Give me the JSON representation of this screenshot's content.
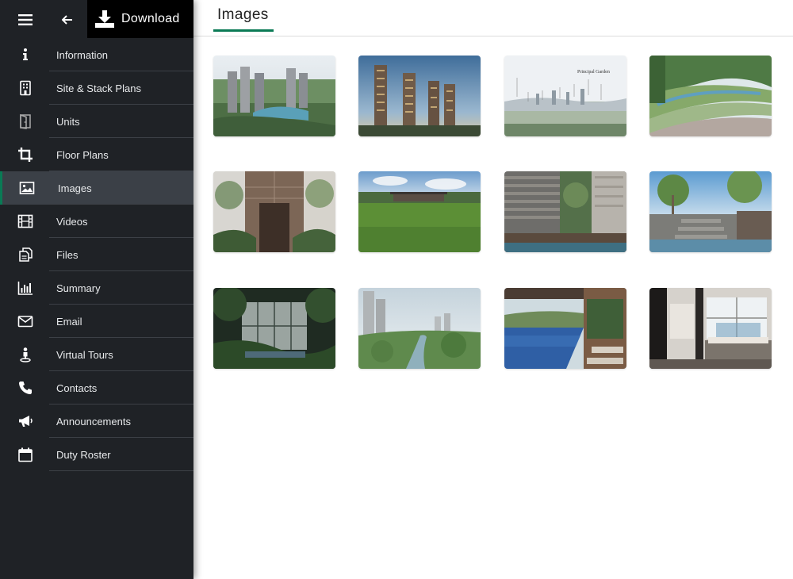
{
  "toolbar": {
    "menu_icon": "hamburger-menu-icon",
    "back_icon": "arrow-left-icon",
    "download_label": "Download",
    "download_icon": "download-icon"
  },
  "sidebar": {
    "items": [
      {
        "label": "Information",
        "icon": "info-icon"
      },
      {
        "label": "Site & Stack Plans",
        "icon": "building-icon"
      },
      {
        "label": "Units",
        "icon": "door-icon"
      },
      {
        "label": "Floor Plans",
        "icon": "crop-icon"
      },
      {
        "label": "Images",
        "icon": "image-icon",
        "active": true
      },
      {
        "label": "Videos",
        "icon": "film-icon"
      },
      {
        "label": "Files",
        "icon": "files-icon"
      },
      {
        "label": "Summary",
        "icon": "bar-chart-icon"
      },
      {
        "label": "Email",
        "icon": "envelope-icon"
      },
      {
        "label": "Virtual Tours",
        "icon": "person-pin-icon"
      },
      {
        "label": "Contacts",
        "icon": "phone-icon"
      },
      {
        "label": "Announcements",
        "icon": "megaphone-icon"
      },
      {
        "label": "Duty Roster",
        "icon": "calendar-icon"
      }
    ]
  },
  "main": {
    "title": "Images",
    "images": [
      {
        "name": "aerial-view-towers"
      },
      {
        "name": "towers-dusk"
      },
      {
        "name": "principal-garden-map",
        "caption": "Principal Garden"
      },
      {
        "name": "terraced-garden"
      },
      {
        "name": "entrance-lobby"
      },
      {
        "name": "lawn-pavilion"
      },
      {
        "name": "stone-wall-courtyard"
      },
      {
        "name": "garden-steps"
      },
      {
        "name": "night-pavilion"
      },
      {
        "name": "riverside-park"
      },
      {
        "name": "lap-pool"
      },
      {
        "name": "bedroom-interior"
      }
    ]
  },
  "colors": {
    "sidebar_bg": "#1f2226",
    "active_bg": "#3b4047",
    "accent": "#0a7a55"
  }
}
